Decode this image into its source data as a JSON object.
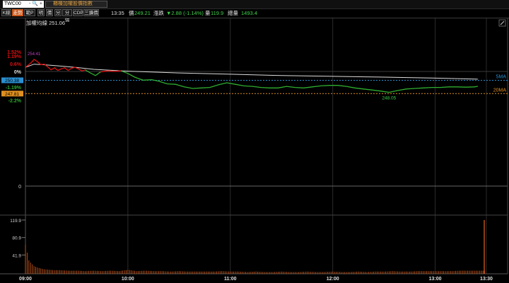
{
  "header": {
    "symbol": "TWC00",
    "symbol_controls": "- 🔍 +",
    "index_name": "櫃檯加權股價指數"
  },
  "toolbar": {
    "buttons": [
      "K線",
      "走勢",
      "範P",
      "明",
      "價",
      "分",
      "分價",
      "CDP",
      "三擴價"
    ]
  },
  "quote": {
    "time": "13:35",
    "price_label": "價",
    "price": "249.21",
    "change_label": "漲跌",
    "change": "▼2.88 (-1.14%)",
    "volume_label": "量",
    "volume": "119.9",
    "total_volume_label": "總量",
    "total_volume": "1493.4"
  },
  "colors": {
    "price_up": "#e01010",
    "price_down": "#2fae2f",
    "avg_line": "#dcdcdc",
    "ma5": "#2a8fd0",
    "ma20": "#e09020",
    "volume": "#c8561a"
  },
  "chart_data": {
    "type": "line",
    "title": "加權均線 251.06",
    "reference_price": 252.09,
    "reference_percent_label": "0%",
    "y_tick_labels": [
      "1.52%",
      "1.19%",
      "0.6%",
      "0%",
      "-0.6%",
      "-1.19%",
      "-2.2%",
      "0"
    ],
    "percent_ticks": [
      1.52,
      1.19,
      0.6,
      0,
      -0.6,
      -1.19,
      -2.2
    ],
    "x_ticks": [
      "09:00",
      "10:00",
      "11:00",
      "12:00",
      "13:00",
      "13:30"
    ],
    "annotations": {
      "high": "254.41",
      "low": "248.05"
    },
    "ma_lines": [
      {
        "name": "5MA",
        "value": "250.38"
      },
      {
        "name": "20MA",
        "value": "247.81"
      }
    ],
    "price_series": [
      [
        "09:00",
        252.9
      ],
      [
        "09:02",
        253.4
      ],
      [
        "09:04",
        254.0
      ],
      [
        "09:05",
        254.41
      ],
      [
        "09:07",
        254.0
      ],
      [
        "09:09",
        253.4
      ],
      [
        "09:11",
        253.5
      ],
      [
        "09:13",
        253.0
      ],
      [
        "09:15",
        252.4
      ],
      [
        "09:17",
        252.8
      ],
      [
        "09:19",
        252.3
      ],
      [
        "09:21",
        252.6
      ],
      [
        "09:23",
        252.8
      ],
      [
        "09:25",
        252.3
      ],
      [
        "09:27",
        252.7
      ],
      [
        "09:29",
        252.9
      ],
      [
        "09:31",
        252.6
      ],
      [
        "09:33",
        252.2
      ],
      [
        "09:35",
        252.4
      ],
      [
        "09:38",
        251.8
      ],
      [
        "09:41",
        251.3
      ],
      [
        "09:44",
        252.0
      ],
      [
        "09:48",
        252.2
      ],
      [
        "09:52",
        252.1
      ],
      [
        "09:56",
        252.2
      ],
      [
        "10:00",
        251.7
      ],
      [
        "10:04",
        251.0
      ],
      [
        "10:09",
        250.4
      ],
      [
        "10:14",
        250.5
      ],
      [
        "10:18",
        250.2
      ],
      [
        "10:23",
        249.7
      ],
      [
        "10:28",
        249.6
      ],
      [
        "10:33",
        249.1
      ],
      [
        "10:38",
        248.8
      ],
      [
        "10:43",
        248.9
      ],
      [
        "10:48",
        249.0
      ],
      [
        "10:53",
        249.5
      ],
      [
        "10:58",
        249.9
      ],
      [
        "11:03",
        249.6
      ],
      [
        "11:08",
        249.3
      ],
      [
        "11:13",
        249.2
      ],
      [
        "11:18",
        249.0
      ],
      [
        "11:23",
        248.9
      ],
      [
        "11:28",
        248.9
      ],
      [
        "11:33",
        249.2
      ],
      [
        "11:38",
        249.0
      ],
      [
        "11:43",
        248.9
      ],
      [
        "11:48",
        249.1
      ],
      [
        "11:53",
        249.3
      ],
      [
        "11:58",
        249.4
      ],
      [
        "12:03",
        249.4
      ],
      [
        "12:08",
        249.2
      ],
      [
        "12:13",
        248.9
      ],
      [
        "12:18",
        248.7
      ],
      [
        "12:23",
        248.5
      ],
      [
        "12:28",
        248.3
      ],
      [
        "12:33",
        248.05
      ],
      [
        "12:38",
        248.4
      ],
      [
        "12:43",
        248.7
      ],
      [
        "12:48",
        248.8
      ],
      [
        "12:53",
        248.9
      ],
      [
        "12:58",
        249.0
      ],
      [
        "13:03",
        249.0
      ],
      [
        "13:08",
        249.1
      ],
      [
        "13:13",
        249.1
      ],
      [
        "13:18",
        249.05
      ],
      [
        "13:23",
        249.1
      ],
      [
        "13:25",
        249.21
      ]
    ],
    "avg_series": [
      [
        "09:00",
        252.9
      ],
      [
        "09:05",
        253.5
      ],
      [
        "09:10",
        253.4
      ],
      [
        "09:20",
        253.15
      ],
      [
        "09:30",
        252.85
      ],
      [
        "09:40",
        252.5
      ],
      [
        "10:00",
        252.15
      ],
      [
        "10:30",
        251.8
      ],
      [
        "11:00",
        251.55
      ],
      [
        "11:30",
        251.3
      ],
      [
        "12:00",
        251.15
      ],
      [
        "12:30",
        251.0
      ],
      [
        "13:00",
        250.8
      ],
      [
        "13:25",
        250.6
      ]
    ],
    "volume_axis_labels": [
      "119.9",
      "80.9",
      "41.9"
    ],
    "volume_max": 119.9,
    "volume": [
      [
        "09:00",
        65
      ],
      [
        "09:01",
        47
      ],
      [
        "09:02",
        30
      ],
      [
        "09:03",
        25
      ],
      [
        "09:04",
        21
      ],
      [
        "09:05",
        17
      ],
      [
        "09:07",
        14
      ],
      [
        "09:09",
        12
      ],
      [
        "09:11",
        10
      ],
      [
        "09:14",
        9
      ],
      [
        "09:17",
        8
      ],
      [
        "09:20",
        8
      ],
      [
        "09:25",
        7
      ],
      [
        "09:30",
        7
      ],
      [
        "09:35",
        6
      ],
      [
        "09:40",
        7
      ],
      [
        "09:45",
        6
      ],
      [
        "09:50",
        7
      ],
      [
        "09:55",
        6
      ],
      [
        "10:00",
        9
      ],
      [
        "10:05",
        6
      ],
      [
        "10:10",
        7
      ],
      [
        "10:15",
        6
      ],
      [
        "10:20",
        6
      ],
      [
        "10:25",
        5
      ],
      [
        "10:30",
        6
      ],
      [
        "10:35",
        5
      ],
      [
        "10:40",
        5
      ],
      [
        "10:45",
        5
      ],
      [
        "10:50",
        5
      ],
      [
        "10:55",
        6
      ],
      [
        "11:00",
        5
      ],
      [
        "11:05",
        5
      ],
      [
        "11:10",
        4
      ],
      [
        "11:15",
        5
      ],
      [
        "11:20",
        4
      ],
      [
        "11:25",
        4
      ],
      [
        "11:30",
        5
      ],
      [
        "11:35",
        4
      ],
      [
        "11:40",
        4
      ],
      [
        "11:45",
        5
      ],
      [
        "11:50",
        4
      ],
      [
        "11:55",
        4
      ],
      [
        "12:00",
        5
      ],
      [
        "12:05",
        4
      ],
      [
        "12:10",
        4
      ],
      [
        "12:15",
        5
      ],
      [
        "12:20",
        4
      ],
      [
        "12:25",
        5
      ],
      [
        "12:30",
        5
      ],
      [
        "12:35",
        6
      ],
      [
        "12:40",
        5
      ],
      [
        "12:45",
        5
      ],
      [
        "12:50",
        6
      ],
      [
        "12:55",
        6
      ],
      [
        "13:00",
        6
      ],
      [
        "13:05",
        6
      ],
      [
        "13:10",
        6
      ],
      [
        "13:15",
        7
      ],
      [
        "13:20",
        7
      ],
      [
        "13:25",
        7
      ],
      [
        "13:30",
        119.9
      ]
    ]
  }
}
